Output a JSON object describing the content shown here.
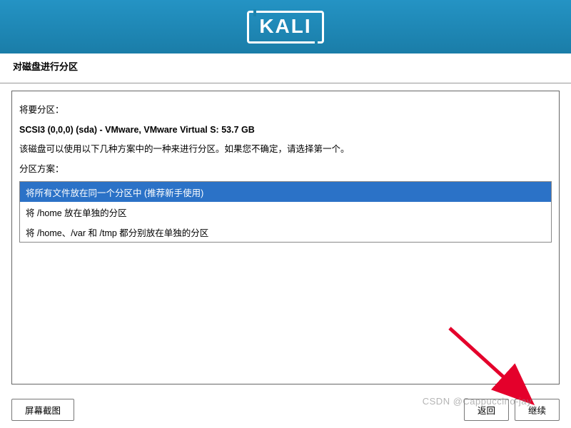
{
  "banner": {
    "logo": "KALI"
  },
  "page": {
    "title": "对磁盘进行分区"
  },
  "panel": {
    "intro_label": "将要分区：",
    "disk": "SCSI3 (0,0,0) (sda) - VMware, VMware Virtual S: 53.7 GB",
    "hint": "该磁盘可以使用以下几种方案中的一种来进行分区。如果您不确定，请选择第一个。",
    "scheme_label": "分区方案：",
    "options": [
      "将所有文件放在同一个分区中 (推荐新手使用)",
      "将 /home 放在单独的分区",
      "将 /home、/var 和 /tmp 都分别放在单独的分区"
    ]
  },
  "footer": {
    "screenshot": "屏幕截图",
    "back": "返回",
    "continue": "继续"
  },
  "watermark": "CSDN @Cappuccino-jay"
}
